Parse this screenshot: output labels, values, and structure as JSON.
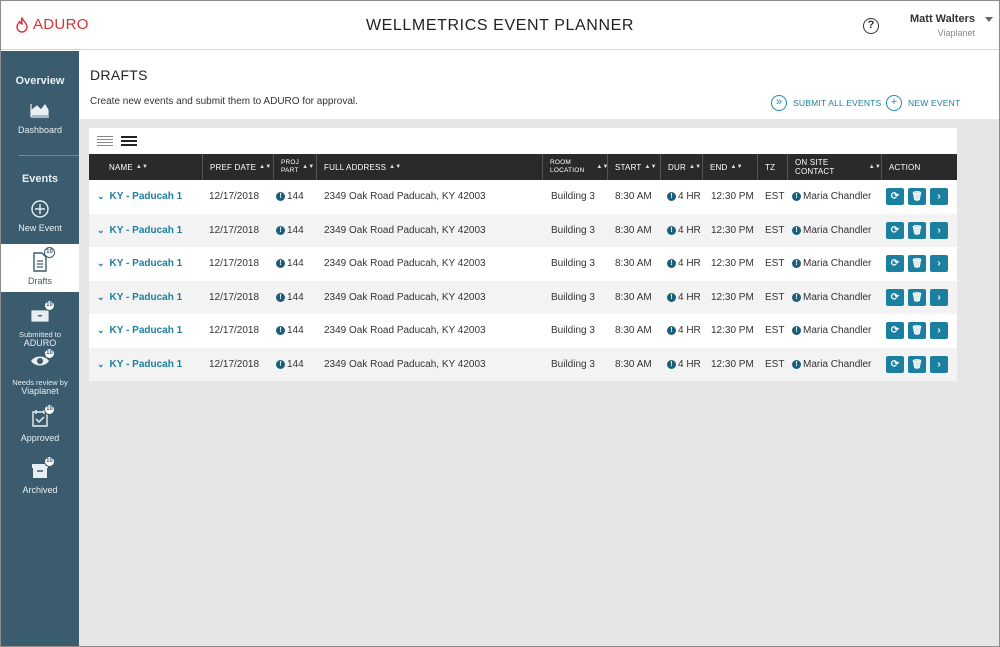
{
  "header": {
    "logo_text": "ADURO",
    "app_title": "WELLMETRICS EVENT PLANNER",
    "help_icon": "?",
    "user_name": "Matt Walters",
    "user_org": "Viaplanet"
  },
  "sidebar": {
    "overview_heading": "Overview",
    "dashboard_label": "Dashboard",
    "events_heading": "Events",
    "new_event_label": "New Event",
    "drafts_label": "Drafts",
    "drafts_badge": "10",
    "submitted_label_1": "Submitted to",
    "submitted_label_2": "ADURO",
    "submitted_badge": "10",
    "review_label_1": "Needs review by",
    "review_label_2": "Viaplanet",
    "review_badge": "10",
    "approved_label": "Approved",
    "approved_badge": "10",
    "archived_label": "Archived",
    "archived_badge": "10"
  },
  "page": {
    "title": "DRAFTS",
    "description": "Create new events and submit them to ADURO for approval.",
    "submit_all_label": "SUBMIT ALL EVENTS",
    "new_event_label": "NEW EVENT"
  },
  "table": {
    "headers": {
      "name": "NAME",
      "pref_date": "PREF DATE",
      "proj_part_1": "PROJ",
      "proj_part_2": "PART",
      "address": "FULL ADDRESS",
      "room_1": "ROOM",
      "room_2": "LOCATION",
      "start": "START",
      "dur": "DUR",
      "end": "END",
      "tz": "TZ",
      "contact": "ON SITE CONTACT",
      "action": "ACTION"
    },
    "rows": [
      {
        "name": "KY - Paducah 1",
        "pref_date": "12/17/2018",
        "proj": "144",
        "address": "2349 Oak Road Paducah, KY 42003",
        "room": "Building 3",
        "start": "8:30 AM",
        "dur": "4 HR",
        "end": "12:30 PM",
        "tz": "EST",
        "contact": "Maria Chandler"
      },
      {
        "name": "KY - Paducah 1",
        "pref_date": "12/17/2018",
        "proj": "144",
        "address": "2349 Oak Road Paducah, KY 42003",
        "room": "Building 3",
        "start": "8:30 AM",
        "dur": "4 HR",
        "end": "12:30 PM",
        "tz": "EST",
        "contact": "Maria Chandler"
      },
      {
        "name": "KY - Paducah 1",
        "pref_date": "12/17/2018",
        "proj": "144",
        "address": "2349 Oak Road Paducah, KY 42003",
        "room": "Building 3",
        "start": "8:30 AM",
        "dur": "4 HR",
        "end": "12:30 PM",
        "tz": "EST",
        "contact": "Maria Chandler"
      },
      {
        "name": "KY - Paducah 1",
        "pref_date": "12/17/2018",
        "proj": "144",
        "address": "2349 Oak Road Paducah, KY 42003",
        "room": "Building 3",
        "start": "8:30 AM",
        "dur": "4 HR",
        "end": "12:30 PM",
        "tz": "EST",
        "contact": "Maria Chandler"
      },
      {
        "name": "KY - Paducah 1",
        "pref_date": "12/17/2018",
        "proj": "144",
        "address": "2349 Oak Road Paducah, KY 42003",
        "room": "Building 3",
        "start": "8:30 AM",
        "dur": "4 HR",
        "end": "12:30 PM",
        "tz": "EST",
        "contact": "Maria Chandler"
      },
      {
        "name": "KY - Paducah 1",
        "pref_date": "12/17/2018",
        "proj": "144",
        "address": "2349 Oak Road Paducah, KY 42003",
        "room": "Building 3",
        "start": "8:30 AM",
        "dur": "4 HR",
        "end": "12:30 PM",
        "tz": "EST",
        "contact": "Maria Chandler"
      }
    ]
  },
  "colors": {
    "sidebar_bg": "#3b5c6e",
    "accent": "#1b7fa0",
    "brand_red": "#d9323a",
    "table_header_bg": "#2a2a2a"
  }
}
